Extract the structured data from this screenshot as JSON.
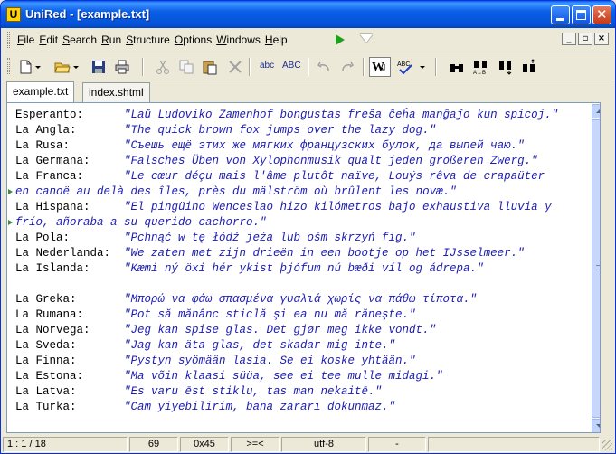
{
  "window": {
    "title": "UniRed - [example.txt]",
    "app_icon_letter": "U"
  },
  "menu": {
    "items": [
      {
        "label": "File",
        "accel": "F"
      },
      {
        "label": "Edit",
        "accel": "E"
      },
      {
        "label": "Search",
        "accel": "S"
      },
      {
        "label": "Run",
        "accel": "R"
      },
      {
        "label": "Structure",
        "accel": "S"
      },
      {
        "label": "Options",
        "accel": "O"
      },
      {
        "label": "Windows",
        "accel": "W"
      },
      {
        "label": "Help",
        "accel": "H"
      }
    ]
  },
  "toolbar": {
    "abc_lower": "abc",
    "abc_upper": "ABC"
  },
  "tabs": [
    {
      "label": "example.txt",
      "active": true
    },
    {
      "label": "index.shtml",
      "active": false
    }
  ],
  "editor": {
    "lines": [
      {
        "label": "Esperanto:",
        "text": "\"Laŭ Ludoviko Zamenhof bongustas freŝa ĉeĥa manĝaĵo kun spicoj.\""
      },
      {
        "label": "La Angla:",
        "text": "\"The quick brown fox jumps over the lazy dog.\""
      },
      {
        "label": "La Rusa:",
        "text": "\"Съешь ещё этих же мягких французских булок, да выпей чаю.\""
      },
      {
        "label": "La Germana:",
        "text": "\"Falsches Üben von Xylophonmusik quält jeden größeren Zwerg.\""
      },
      {
        "label": "La Franca:",
        "text": "\"Le cœur déçu mais l'âme plutôt naïve, Louÿs rêva de crapaüter"
      },
      {
        "label": "",
        "text": "en canoë au delà des îles, près du mälström où brûlent les novæ.\"",
        "continuation": true
      },
      {
        "label": "La Hispana:",
        "text": "\"El pingüino Wenceslao hizo kilómetros bajo exhaustiva lluvia y"
      },
      {
        "label": "",
        "text": "frío, añoraba a su querido cachorro.\"",
        "continuation": true
      },
      {
        "label": "La Pola:",
        "text": "\"Pchnąć w tę łódź jeża lub ośm skrzyń fig.\""
      },
      {
        "label": "La Nederlanda:",
        "text": "\"We zaten met zijn drieën in een bootje op het IJsselmeer.\""
      },
      {
        "label": "La Islanda:",
        "text": "\"Kæmi ný öxi hér ykist þjófum nú bæði víl og ádrepa.\""
      },
      {
        "label": "",
        "text": ""
      },
      {
        "label": "La Greka:",
        "text": "\"Μπορώ να φάω σπασμένα γυαλιά χωρίς να πάθω τίποτα.\""
      },
      {
        "label": "La Rumana:",
        "text": "\"Pot să mănânc sticlă şi ea nu mă răneşte.\""
      },
      {
        "label": "La Norvega:",
        "text": "\"Jeg kan spise glas. Det gjør meg ikke vondt.\""
      },
      {
        "label": "La Sveda:",
        "text": "\"Jag kan äta glas, det skadar mig inte.\""
      },
      {
        "label": "La Finna:",
        "text": "\"Pystyn syömään lasia. Se ei koske yhtään.\""
      },
      {
        "label": "La Estona:",
        "text": "\"Ma võin klaasi süüa, see ei tee mulle midagi.\""
      },
      {
        "label": "La Latva:",
        "text": "\"Es varu ēst stiklu, tas man nekaitē.\""
      },
      {
        "label": "La Turka:",
        "text": "\"Cam yiyebilirim, bana zararı dokunmaz.\""
      }
    ]
  },
  "status": {
    "position": "1 : 1 / 18",
    "char_code_dec": "69",
    "char_code_hex": "0x45",
    "direction": ">=<",
    "encoding": "utf-8",
    "extra": "-"
  },
  "colors": {
    "string": "#1b1bb3",
    "title_bar": "#0553d8",
    "wrap_marker": "#3c8c3c"
  }
}
